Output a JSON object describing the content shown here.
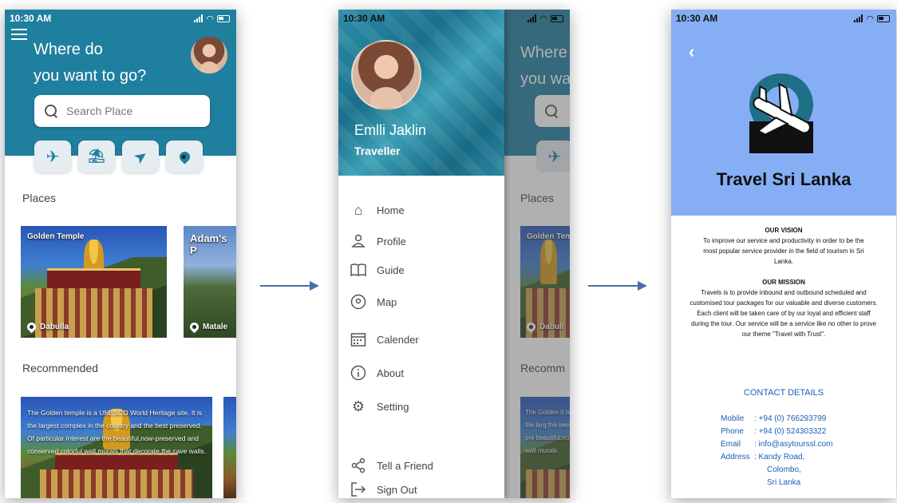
{
  "status": {
    "time": "10:30 AM"
  },
  "home": {
    "headline_line1": "Where do",
    "headline_line2": "you want to go?",
    "search_placeholder": "Search Place",
    "categories": [
      {
        "name": "flights",
        "icon": "airplane-icon",
        "glyph": "✈"
      },
      {
        "name": "beach",
        "icon": "beach-umbrella-icon",
        "glyph": "⛱"
      },
      {
        "name": "navigate",
        "icon": "navigation-arrow-icon",
        "glyph": "➤"
      },
      {
        "name": "location",
        "icon": "map-pin-icon",
        "glyph": "●"
      }
    ],
    "places_title": "Places",
    "places": [
      {
        "title": "Golden Temple",
        "location": "Dabulla"
      },
      {
        "title": "Adam's P",
        "location": "Matale"
      }
    ],
    "recommended_title": "Recommended",
    "recommended_text": "The Golden temple is a UNESCO World Heritage site. It is the largest complex in the country and the best preserved. Of particular interest are the beautiful,now-preserved and conserved colorful wall murals that decorate the cave walls."
  },
  "drawer": {
    "user_name": "Emlli Jaklin",
    "user_role": "Traveller",
    "menu": [
      {
        "label": "Home",
        "icon": "home-icon"
      },
      {
        "label": "Profile",
        "icon": "profile-icon"
      },
      {
        "label": "Guide",
        "icon": "book-icon"
      },
      {
        "label": "Map",
        "icon": "map-pin-icon"
      },
      {
        "label": "Calender",
        "icon": "calendar-icon"
      },
      {
        "label": "About",
        "icon": "info-icon"
      },
      {
        "label": "Setting",
        "icon": "gear-icon"
      }
    ],
    "bottom_menu": [
      {
        "label": "Tell a Friend",
        "icon": "share-icon"
      },
      {
        "label": "Sign Out",
        "icon": "sign-out-icon"
      }
    ],
    "behind_headline1": "Where",
    "behind_headline2": "you wa",
    "behind_places": "Places",
    "behind_card_title": "Golden Tem",
    "behind_card_loc": "Dabull",
    "behind_recommended": "Recomm",
    "behind_rec_text": "The Golden It is the larg the best pre beautiful,no wall murals"
  },
  "about": {
    "title": "Travel Sri Lanka",
    "vision_heading": "OUR VISION",
    "vision_text": "To improve our service and productivity in order to be the most popular service provider in the field of tourism in Sri Lanka.",
    "mission_heading": "OUR MISSION",
    "mission_text": "Travels is to provide inbound and outbound scheduled and customised tour packages for our valuable and diverse customers. Each client will be taken care of by our loyal and efficient staff during the tour. Our service will be a service like no other to prove our theme \"Travel with Trust\".",
    "contact_title": "CONTACT DETAILS",
    "contact": {
      "mobile_label": "Mobile",
      "mobile": ": +94 (0) 766293799",
      "phone_label": "Phone",
      "phone": ": +94 (0) 524303322",
      "email_label": "Email",
      "email": ": info@asytourssl.com",
      "address_label": "Address",
      "address1": ": Kandy Road,",
      "address2": "Colombo,",
      "address3": "Sri Lanka"
    }
  },
  "colors": {
    "primary": "#1f7f9e",
    "about_header": "#85aef5",
    "contact_blue": "#1a5fb5"
  }
}
